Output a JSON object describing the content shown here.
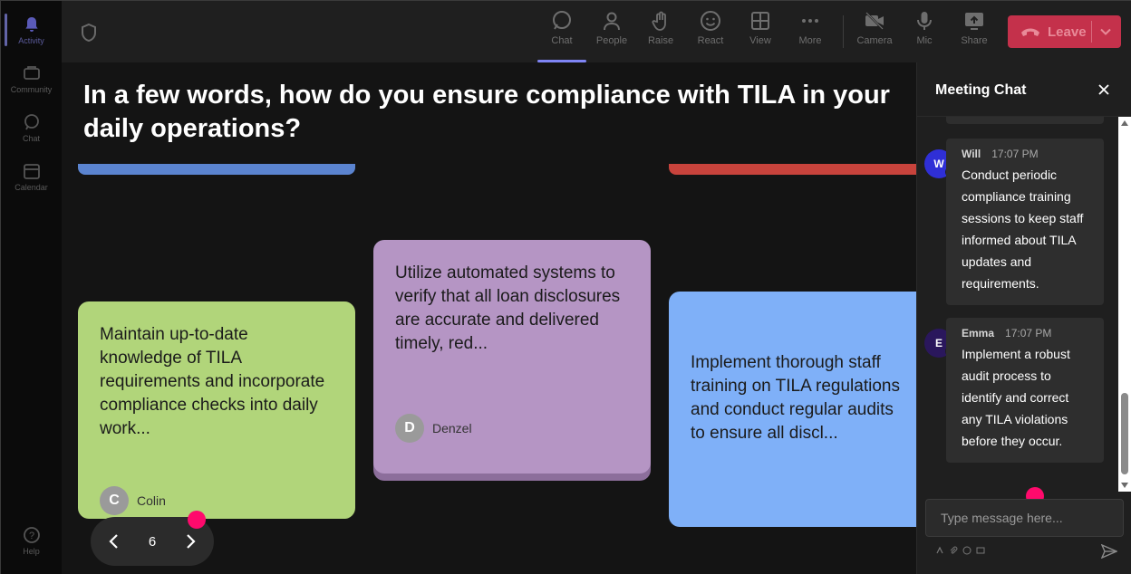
{
  "rail": {
    "items": [
      {
        "label": "Activity",
        "icon": "bell-icon",
        "active": true
      },
      {
        "label": "Community",
        "icon": "community-icon"
      },
      {
        "label": "Chat",
        "icon": "chat-icon"
      },
      {
        "label": "Calendar",
        "icon": "calendar-icon"
      }
    ],
    "help": {
      "label": "Help",
      "icon": "help-icon"
    }
  },
  "toolbar": {
    "buttons": [
      {
        "label": "Chat",
        "icon": "chat-icon",
        "active": true
      },
      {
        "label": "People",
        "icon": "people-icon"
      },
      {
        "label": "Raise",
        "icon": "raise-hand-icon"
      },
      {
        "label": "React",
        "icon": "smiley-icon"
      },
      {
        "label": "View",
        "icon": "grid-view-icon"
      },
      {
        "label": "More",
        "icon": "more-icon"
      },
      {
        "label": "Camera",
        "icon": "camera-off-icon"
      },
      {
        "label": "Mic",
        "icon": "mic-icon"
      },
      {
        "label": "Share",
        "icon": "share-icon"
      }
    ],
    "leave_label": "Leave",
    "leave_color": "#c4314b"
  },
  "stage": {
    "question": "In a few words, how do you ensure compliance with TILA in your daily operations?",
    "cards": [
      {
        "text": "Maintain up-to-date knowledge of TILA requirements and incorporate compliance checks into daily work...",
        "author": "Colin",
        "initial": "C",
        "color": "#b1d57a"
      },
      {
        "text": "Utilize automated systems to verify that all loan disclosures are accurate and delivered timely, red...",
        "author": "Denzel",
        "initial": "D",
        "color": "#b595c4"
      },
      {
        "text": "Implement thorough staff training on TILA regulations and conduct regular audits to ensure all discl...",
        "color": "#7fb0f8"
      }
    ],
    "strip_colors": {
      "left": "#5b84d0",
      "right": "#c8433c"
    },
    "page_number": "6"
  },
  "chat": {
    "title": "Meeting Chat",
    "messages": [
      {
        "author": "Will",
        "initial": "W",
        "time": "17:07 PM",
        "avatar_color": "#2f2fd6",
        "text": "Conduct periodic compliance training sessions to keep staff informed about TILA updates and requirements."
      },
      {
        "author": "Emma",
        "initial": "E",
        "time": "17:07 PM",
        "avatar_color": "#2a175c",
        "text": "Implement a robust audit process to identify and correct any TILA violations before they occur."
      }
    ],
    "compose_placeholder": "Type message here..."
  }
}
